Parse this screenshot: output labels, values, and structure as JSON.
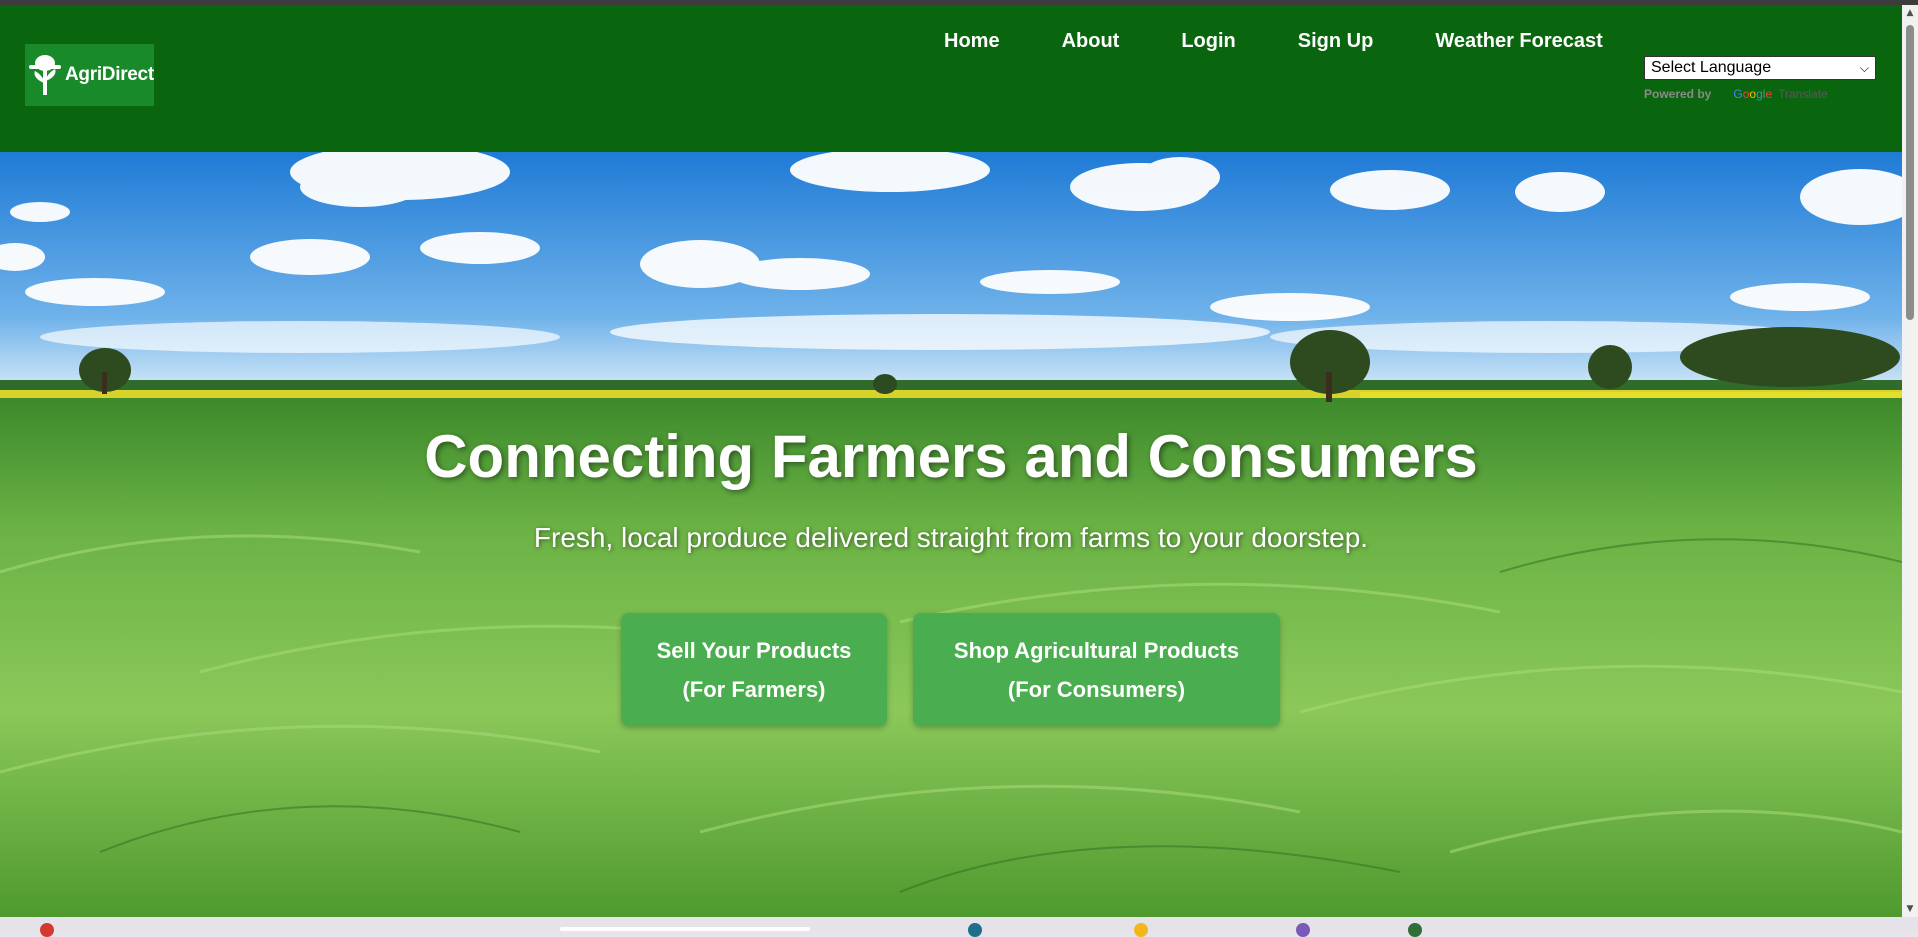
{
  "brand": {
    "name": "AgriDirect"
  },
  "nav": {
    "items": [
      {
        "label": "Home"
      },
      {
        "label": "About"
      },
      {
        "label": "Login"
      },
      {
        "label": "Sign Up"
      },
      {
        "label": "Weather Forecast"
      }
    ]
  },
  "translate": {
    "select_value": "Select Language",
    "powered_by": "Powered by",
    "google": "Google",
    "translate_word": "Translate"
  },
  "hero": {
    "title": "Connecting Farmers and Consumers",
    "subtitle": "Fresh, local produce delivered straight from farms to your doorstep.",
    "farmers_button": {
      "line1": "Sell Your Products",
      "line2": "(For Farmers)"
    },
    "consumers_button": {
      "line1": "Shop Agricultural Products",
      "line2": "(For Consumers)"
    }
  },
  "colors": {
    "header_bg": "#0a650f",
    "logo_bg": "#198a2a",
    "button_bg": "#4aad4f",
    "sky": "#3a8fd8",
    "grass": "#5fb33a"
  },
  "icons": {
    "logo": "farmer-tree-icon",
    "select": "chevron-down-icon",
    "scroll_up": "scroll-up-arrow-icon",
    "scroll_down": "scroll-down-arrow-icon"
  }
}
